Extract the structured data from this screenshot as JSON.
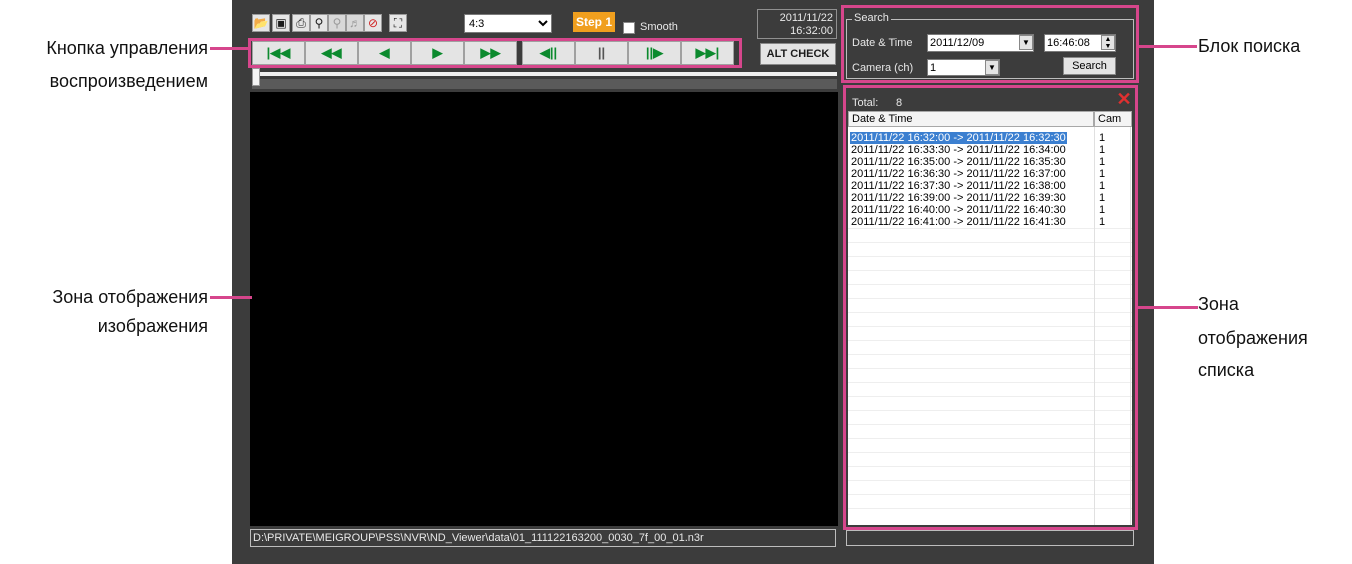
{
  "toolbar": {
    "aspect_ratio": "4:3",
    "step_label": "Step 1",
    "smooth_label": "Smooth",
    "clock_date": "2011/11/22",
    "clock_time": "16:32:00",
    "alt_check_label": "ALT CHECK"
  },
  "playback_icons": [
    "skip-to-start-icon",
    "fast-rewind-icon",
    "reverse-play-icon",
    "play-icon",
    "fast-forward-icon",
    "step-back-icon",
    "pause-icon",
    "step-forward-icon",
    "skip-to-end-icon"
  ],
  "search": {
    "group_label": "Search",
    "date_time_label": "Date & Time",
    "date_value": "2011/12/09",
    "time_value": "16:46:08",
    "camera_label": "Camera (ch)",
    "camera_value": "1",
    "search_button": "Search"
  },
  "list": {
    "total_label": "Total:",
    "total_count": "8",
    "col_datetime": "Date & Time",
    "col_cam": "Cam",
    "rows": [
      {
        "dt": "2011/11/22 16:32:00 -> 2011/11/22 16:32:30",
        "cam": "1"
      },
      {
        "dt": "2011/11/22 16:33:30 -> 2011/11/22 16:34:00",
        "cam": "1"
      },
      {
        "dt": "2011/11/22 16:35:00 -> 2011/11/22 16:35:30",
        "cam": "1"
      },
      {
        "dt": "2011/11/22 16:36:30 -> 2011/11/22 16:37:00",
        "cam": "1"
      },
      {
        "dt": "2011/11/22 16:37:30 -> 2011/11/22 16:38:00",
        "cam": "1"
      },
      {
        "dt": "2011/11/22 16:39:00 -> 2011/11/22 16:39:30",
        "cam": "1"
      },
      {
        "dt": "2011/11/22 16:40:00 -> 2011/11/22 16:40:30",
        "cam": "1"
      },
      {
        "dt": "2011/11/22 16:41:00 -> 2011/11/22 16:41:30",
        "cam": "1"
      }
    ]
  },
  "file_path": "D:\\PRIVATE\\MEIGROUP\\PSS\\NVR\\ND_Viewer\\data\\01_111122163200_0030_7f_00_01.n3r",
  "annotations": {
    "playback_line1": "Кнопка управления",
    "playback_line2": "воспроизведением",
    "image_line1": "Зона отображения",
    "image_line2": "изображения",
    "search_block": "Блок поиска",
    "list_line1": "Зона",
    "list_line2": "отображения",
    "list_line3": "списка"
  },
  "colors": {
    "annotation_pink": "#d6468c",
    "window_bg": "#3c3c3c",
    "step_orange": "#f09f1e",
    "selection_blue": "#3b7fd0",
    "play_green": "#0c8a2e"
  }
}
